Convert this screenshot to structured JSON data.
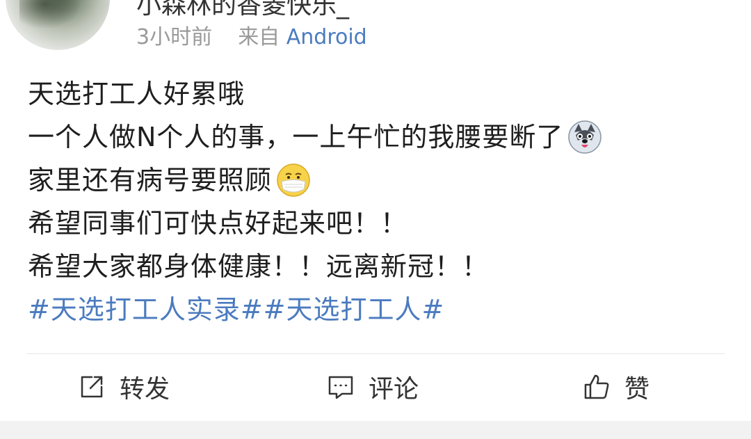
{
  "user": {
    "name": "小森林的香菱快乐_"
  },
  "meta": {
    "time": "3小时前",
    "from_label": "来自",
    "source": "Android"
  },
  "post": {
    "lines": [
      "天选打工人好累哦",
      "一个人做N个人的事，一上午忙的我腰要断了",
      "家里还有病号要照顾",
      "希望同事们可快点好起来吧！！",
      "希望大家都身体健康！！远离新冠！！"
    ],
    "topics": "#天选打工人实录##天选打工人#",
    "emojis": [
      "husky-emoji",
      "mask-face-emoji"
    ]
  },
  "actions": {
    "repost_label": "转发",
    "comment_label": "评论",
    "like_label": "赞"
  },
  "colors": {
    "link": "#4b7bbf",
    "meta_text": "#9a9a9a",
    "body_text": "#1e1e1e"
  }
}
